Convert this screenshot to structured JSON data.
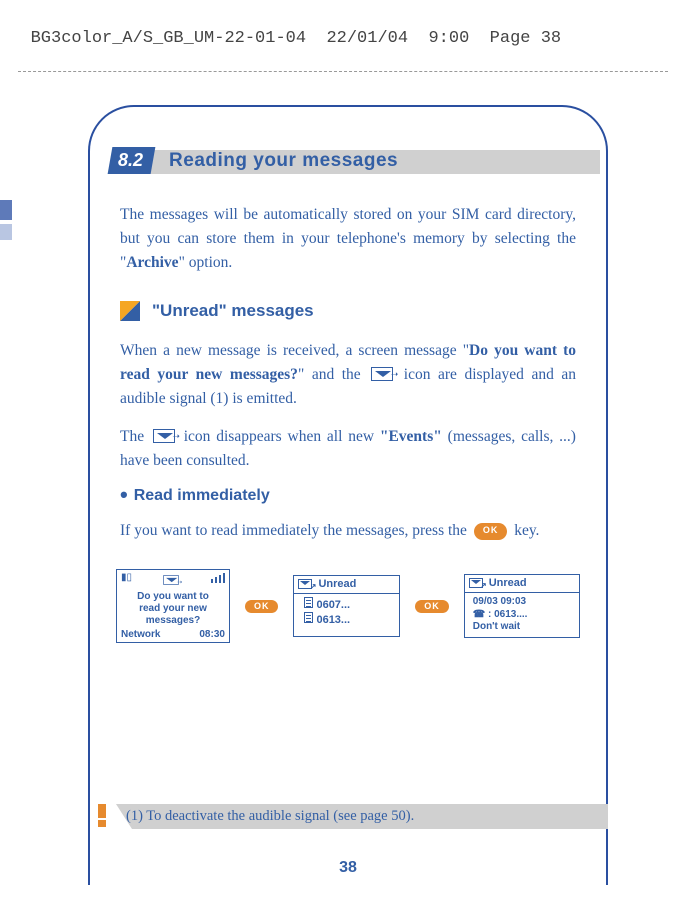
{
  "crop_header": " BG3color_A/S_GB_UM-22-01-04  22/01/04  9:00  Page 38",
  "section": {
    "number": "8.2",
    "title": "Reading your messages"
  },
  "intro_para": {
    "pre": "The messages will be automatically stored on your SIM card directory, but you can store them in your telephone's memory by selecting the \"",
    "bold": "Archive",
    "post": "\" option."
  },
  "subsection_unread": "\"Unread\" messages",
  "unread_p1": {
    "a": "When a new message is received, a screen message \"",
    "b": "Do you want to read your new messages?",
    "c": "\" and the ",
    "d": " icon are displayed and an audible signal (1) is emitted."
  },
  "unread_p2": {
    "a": "The ",
    "b": " icon disappears when all new ",
    "c": "\"Events\"",
    "d": " (messages, calls, ...) have been consulted."
  },
  "bullet_heading": "Read immediately",
  "read_imm_para": {
    "a": "If you want to read immediately the messages, press the ",
    "b": " key."
  },
  "screens": {
    "s1": {
      "msg_l1": "Do you want to",
      "msg_l2": "read your new",
      "msg_l3": "messages?",
      "network": "Network",
      "time": "08:30"
    },
    "s2": {
      "title": "Unread",
      "line1": "0607...",
      "line2": "0613..."
    },
    "s3": {
      "title": "Unread",
      "line1": "09/03 09:03",
      "line2": "☎ : 0613....",
      "line3": "Don't wait"
    },
    "ok_label": "OK"
  },
  "footnote": "(1)   To deactivate the audible signal (see page 50).",
  "page_number": "38"
}
